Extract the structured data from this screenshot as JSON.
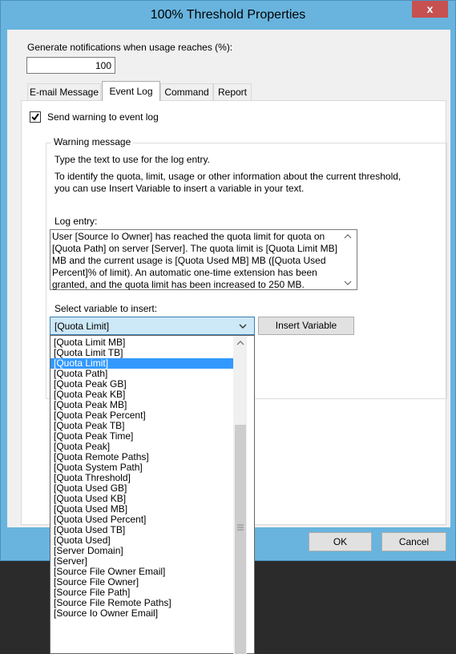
{
  "window": {
    "title": "100% Threshold Properties",
    "close_glyph": "x"
  },
  "threshold": {
    "label": "Generate notifications when usage reaches (%):",
    "value": "100"
  },
  "tabs": [
    {
      "label": "E-mail Message"
    },
    {
      "label": "Event Log"
    },
    {
      "label": "Command"
    },
    {
      "label": "Report"
    }
  ],
  "event_log": {
    "checkbox_label": "Send warning to event log",
    "checked": true,
    "group_title": "Warning message",
    "instruction1": "Type the text to use for the log entry.",
    "instruction2a": "To identify the quota, limit, usage or other information about the current threshold,",
    "instruction2b": "you can use Insert Variable to insert a variable in your text.",
    "log_entry_label": "Log entry:",
    "log_entry_text": "User [Source Io Owner] has reached the quota limit for quota on [Quota Path] on server [Server]. The quota limit is [Quota Limit MB] MB and the current usage is [Quota Used MB] MB ([Quota Used Percent]% of limit). An automatic one-time extension has been granted, and the quota limit has been increased to 250 MB.",
    "select_label": "Select variable to insert:",
    "selected_variable": "[Quota Limit]",
    "insert_button": "Insert Variable"
  },
  "variables": [
    "[Quota Limit MB]",
    "[Quota Limit TB]",
    "[Quota Limit]",
    "[Quota Path]",
    "[Quota Peak GB]",
    "[Quota Peak KB]",
    "[Quota Peak MB]",
    "[Quota Peak Percent]",
    "[Quota Peak TB]",
    "[Quota Peak Time]",
    "[Quota Peak]",
    "[Quota Remote Paths]",
    "[Quota System Path]",
    "[Quota Threshold]",
    "[Quota Used GB]",
    "[Quota Used KB]",
    "[Quota Used MB]",
    "[Quota Used Percent]",
    "[Quota Used TB]",
    "[Quota Used]",
    "[Server Domain]",
    "[Server]",
    "[Source File Owner Email]",
    "[Source File Owner]",
    "[Source File Path]",
    "[Source File Remote Paths]",
    "[Source Io Owner Email]"
  ],
  "selected_index": 2,
  "buttons": {
    "ok": "OK",
    "cancel": "Cancel"
  },
  "icons": {
    "check": "check-icon",
    "scroll_up": "chevron-up-icon",
    "scroll_down": "chevron-down-icon",
    "combo": "chevron-down-icon"
  }
}
